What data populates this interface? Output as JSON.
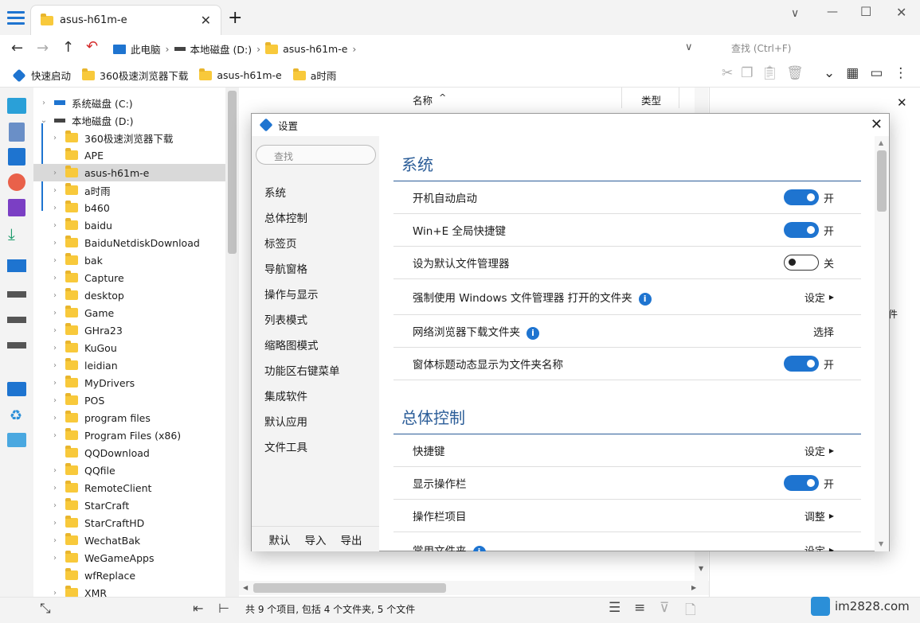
{
  "tab": {
    "title": "asus-h61m-e",
    "close": "✕",
    "new": "+"
  },
  "window": {
    "minimize": "—",
    "maximize": "☐",
    "close": "✕"
  },
  "breadcrumb": [
    "此电脑",
    "本地磁盘 (D:)",
    "asus-h61m-e"
  ],
  "search": {
    "placeholder": "查找 (Ctrl+F)"
  },
  "quickbar": [
    "快速启动",
    "360极速浏览器下载",
    "asus-h61m-e",
    "a时雨"
  ],
  "tree": {
    "drives": [
      "系统磁盘 (C:)",
      "本地磁盘 (D:)"
    ],
    "folders": [
      "360极速浏览器下载",
      "APE",
      "asus-h61m-e",
      "a时雨",
      "b460",
      "baidu",
      "BaiduNetdiskDownload",
      "bak",
      "Capture",
      "desktop",
      "Game",
      "GHra23",
      "KuGou",
      "leidian",
      "MyDrivers",
      "POS",
      "program files",
      "Program Files (x86)",
      "QQDownload",
      "QQfile",
      "RemoteClient",
      "StarCraft",
      "StarCraftHD",
      "WechatBak",
      "WeGameApps",
      "wfReplace",
      "XMR"
    ],
    "selected_index": 2
  },
  "list": {
    "col_name": "名称",
    "col_type": "类型",
    "sort_arrow": "^"
  },
  "preview": {
    "close": "✕",
    "fragment": "件"
  },
  "status": {
    "text": "共 9 个项目, 包括 4 个文件夹, 5 个文件"
  },
  "dialog": {
    "title": "设置",
    "search_placeholder": "查找",
    "nav": [
      "系统",
      "总体控制",
      "标签页",
      "导航窗格",
      "操作与显示",
      "列表模式",
      "缩略图模式",
      "功能区右键菜单",
      "集成软件",
      "默认应用",
      "文件工具"
    ],
    "footer": [
      "默认",
      "导入",
      "导出"
    ],
    "sections": [
      {
        "title": "系统",
        "items": [
          {
            "label": "开机自动启动",
            "control": "toggle",
            "on": true,
            "value": "开"
          },
          {
            "label": "Win+E 全局快捷键",
            "control": "toggle",
            "on": true,
            "value": "开"
          },
          {
            "label": "设为默认文件管理器",
            "control": "toggle",
            "on": false,
            "value": "关"
          },
          {
            "label": "强制使用 Windows 文件管理器 打开的文件夹",
            "control": "link",
            "value": "设定",
            "info": true
          },
          {
            "label": "网络浏览器下载文件夹",
            "control": "link",
            "value": "选择",
            "info": true
          },
          {
            "label": "窗体标题动态显示为文件夹名称",
            "control": "toggle",
            "on": true,
            "value": "开"
          }
        ]
      },
      {
        "title": "总体控制",
        "items": [
          {
            "label": "快捷键",
            "control": "link",
            "value": "设定"
          },
          {
            "label": "显示操作栏",
            "control": "toggle",
            "on": true,
            "value": "开"
          },
          {
            "label": "操作栏项目",
            "control": "link",
            "value": "调整"
          },
          {
            "label": "常用文件夹",
            "control": "link",
            "value": "设定",
            "info": true
          }
        ]
      }
    ]
  },
  "watermark": "im2828.com",
  "colors": {
    "accent": "#1e74d0",
    "section": "#2b5d98",
    "folder": "#f8c93b"
  }
}
